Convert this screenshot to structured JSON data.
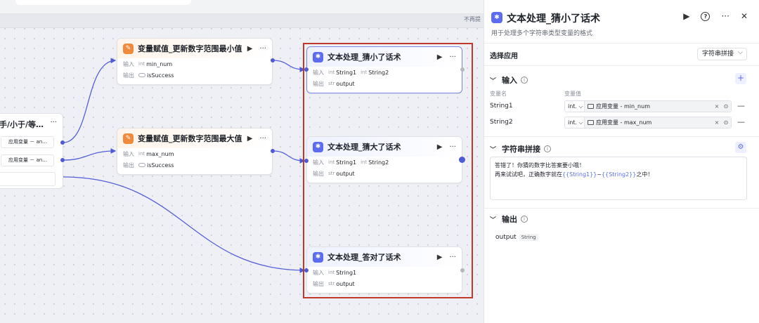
{
  "canvas": {
    "hint": "不再提",
    "condition_node": {
      "title": "手/小于/等…",
      "options": [
        "应用变量 － an…",
        "应用变量 － an…"
      ]
    },
    "nodes": [
      {
        "id": "n1",
        "kind": "var",
        "title": "变量赋值_更新数字范围最小值",
        "in_label": "输入",
        "out_label": "输出",
        "inputs": [
          {
            "type": "int",
            "name": "min_num"
          }
        ],
        "outputs": [
          {
            "type": "toggle",
            "name": "isSuccess"
          }
        ]
      },
      {
        "id": "n2",
        "kind": "var",
        "title": "变量赋值_更新数字范围最大值",
        "in_label": "输入",
        "out_label": "输出",
        "inputs": [
          {
            "type": "int",
            "name": "max_num"
          }
        ],
        "outputs": [
          {
            "type": "toggle",
            "name": "isSuccess"
          }
        ]
      },
      {
        "id": "n3",
        "kind": "txt",
        "title": "文本处理_猜小了话术",
        "in_label": "输入",
        "out_label": "输出",
        "inputs": [
          {
            "type": "int",
            "name": "String1"
          },
          {
            "type": "int",
            "name": "String2"
          }
        ],
        "outputs": [
          {
            "type": "str",
            "name": "output"
          }
        ]
      },
      {
        "id": "n4",
        "kind": "txt",
        "title": "文本处理_猜大了话术",
        "in_label": "输入",
        "out_label": "输出",
        "inputs": [
          {
            "type": "int",
            "name": "String1"
          },
          {
            "type": "int",
            "name": "String2"
          }
        ],
        "outputs": [
          {
            "type": "str",
            "name": "output"
          }
        ]
      },
      {
        "id": "n5",
        "kind": "txt",
        "title": "文本处理_答对了话术",
        "in_label": "输入",
        "out_label": "输出",
        "inputs": [
          {
            "type": "int",
            "name": "String1"
          }
        ],
        "outputs": [
          {
            "type": "str",
            "name": "output"
          }
        ]
      }
    ]
  },
  "panel": {
    "title": "文本处理_猜小了话术",
    "subtitle": "用于处理多个字符串类型变量的格式",
    "app_label": "选择应用",
    "app_value": "字符串拼接",
    "input_section": "输入",
    "col_name": "变量名",
    "col_value": "变量值",
    "variables": [
      {
        "name": "String1",
        "type": "int.",
        "value": "应用变量 - min_num"
      },
      {
        "name": "String2",
        "type": "int.",
        "value": "应用变量 - max_num"
      }
    ],
    "concat_section": "字符串拼接",
    "text_line1": "答错了！你猜的数字比答案要小哦！",
    "text_line2_pre": "再来试试吧，正确数字就在",
    "text_var1": "{{String1}}",
    "text_sep": "~",
    "text_var2": "{{String2}}",
    "text_line2_post": "之中！",
    "output_section": "输出",
    "output_name": "output",
    "output_type": "String"
  },
  "colors": {
    "accent": "#5b6cf0",
    "highlight_box": "#c0392b",
    "var_node": "#f08a3c"
  }
}
